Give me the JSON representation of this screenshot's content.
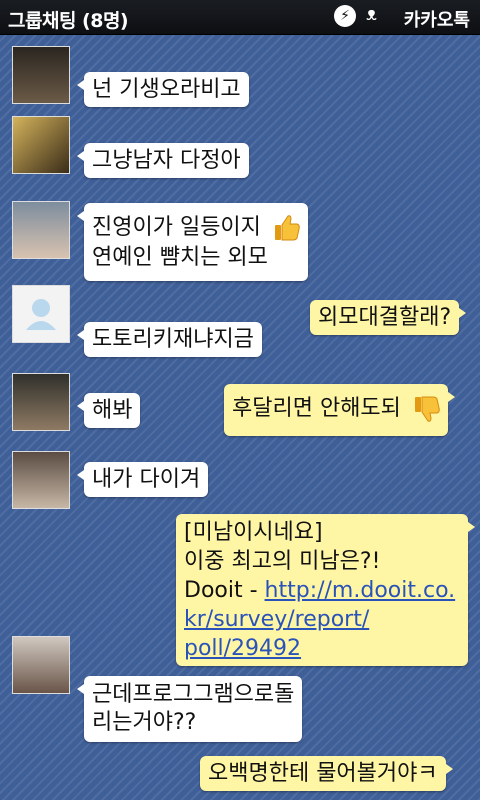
{
  "header": {
    "title": "그룹채팅 (8명)",
    "brand": "카카오톡",
    "flash_icon": "lightning-icon",
    "brand_icon": "kakao-bear-icon"
  },
  "messages": [
    {
      "side": "in",
      "text": "넌 기생오라비고"
    },
    {
      "side": "in",
      "text": "그냥남자 다정아"
    },
    {
      "side": "in",
      "lines": [
        "진영이가 일등이지",
        "연예인 뺨치는 외모"
      ],
      "emoticon": "thumbs-up-icon"
    },
    {
      "side": "out",
      "text": "외모대결할래?"
    },
    {
      "side": "in",
      "text": "도토리키재냐지금"
    },
    {
      "side": "in",
      "text": "해봐"
    },
    {
      "side": "out",
      "text": "후달리면 안해도되",
      "emoticon": "thumbs-down-icon"
    },
    {
      "side": "in",
      "text": "내가 다이겨"
    },
    {
      "side": "out",
      "lines": [
        "[미남이시네요]",
        "이중 최고의 미남은?!",
        "Dooit - "
      ],
      "link_lines": [
        "http://m.dooit.co.",
        "kr/survey/report/",
        "poll/29492"
      ]
    },
    {
      "side": "in",
      "lines": [
        "근데프로그그램으로돌",
        "리는거야??"
      ]
    },
    {
      "side": "out",
      "text": "오백명한테 물어볼거야ㅋ"
    }
  ],
  "colors": {
    "background": "#3f5f98",
    "incoming_bubble": "#ffffff",
    "outgoing_bubble": "#fff6a5",
    "link": "#2a53b9"
  }
}
